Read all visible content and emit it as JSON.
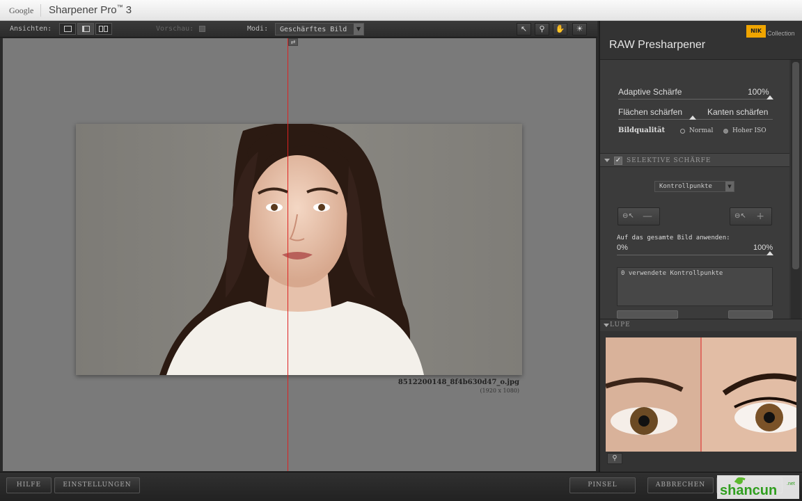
{
  "titlebar": {
    "brand": "Google",
    "app_name": "Sharpener Pro",
    "tm": "™",
    "version": "3"
  },
  "toolbar": {
    "ansichten_label": "Ansichten:",
    "vorschau_label": "Vorschau:",
    "modi_label": "Modi:",
    "modi_value": "Geschärftes Bild"
  },
  "canvas": {
    "filename": "8512200148_8f4b630d47_o.jpg",
    "filedims": "(1920 x 1080)"
  },
  "panel": {
    "collection": "Collection",
    "nik_logo": "NIK",
    "title": "RAW Presharpener",
    "adaptive_label": "Adaptive Schärfe",
    "adaptive_value": "100%",
    "adaptive_level": 1.0,
    "flaechen_label": "Flächen schärfen",
    "kanten_label": "Kanten schärfen",
    "flaechen_kanten_level": 0.5,
    "bildqualitaet_label": "Bildqualität",
    "radio_normal": "Normal",
    "radio_iso": "Hoher ISO",
    "selective_section": "SELEKTIVE SCHÄRFE",
    "kp_select": "Kontrollpunkte",
    "apply_label": "Auf das gesamte Bild anwenden:",
    "apply_min": "0%",
    "apply_max": "100%",
    "apply_level": 1.0,
    "cp_list_text": "0 verwendete Kontrollpunkte",
    "lupe_section": "LUPE"
  },
  "bottom": {
    "hilfe": "HILFE",
    "einstellungen": "EINSTELLUNGEN",
    "pinsel": "PINSEL",
    "abbrechen": "ABBRECHEN"
  },
  "colors": {
    "split_line": "#d22222",
    "accent_logo": "#f0a500"
  }
}
